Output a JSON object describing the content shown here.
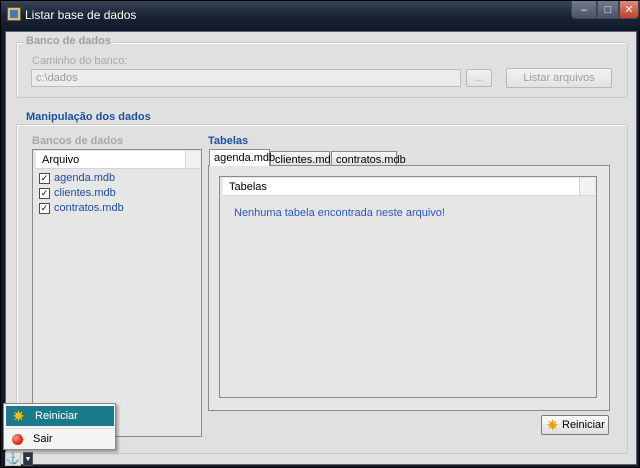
{
  "window": {
    "title": "Listar base de dados",
    "buttons": {
      "minimize": "–",
      "maximize": "□",
      "close": "✕"
    }
  },
  "db_group": {
    "legend": "Banco de dados",
    "path_label": "Caminho do banco:",
    "path_value": "c:\\dados",
    "browse_label": "...",
    "list_button": "Listar arquivos"
  },
  "manip_group": {
    "legend": "Manipulação dos dados",
    "banks_label": "Bancos de dados",
    "column_header": "Arquivo",
    "files": [
      {
        "name": "agenda.mdb",
        "checked": true
      },
      {
        "name": "clientes.mdb",
        "checked": true
      },
      {
        "name": "contratos.mdb",
        "checked": true
      }
    ],
    "tables_label": "Tabelas",
    "tabs": [
      "agenda.mdb",
      "clientes.mdb",
      "contratos.mdb"
    ],
    "active_tab": "agenda.mdb",
    "tables_header": "Tabelas",
    "empty_message": "Nenhuma tabela encontrada neste arquivo!",
    "reset_button": "Reiniciar"
  },
  "context_menu": {
    "items": [
      {
        "label": "Reiniciar",
        "icon": "sun-icon",
        "highlighted": true
      },
      {
        "label": "Sair",
        "icon": "red-ball-icon",
        "highlighted": false
      }
    ]
  },
  "colors": {
    "accent_blue": "#1f4fa0",
    "menu_highlight": "#1a7a8a"
  }
}
